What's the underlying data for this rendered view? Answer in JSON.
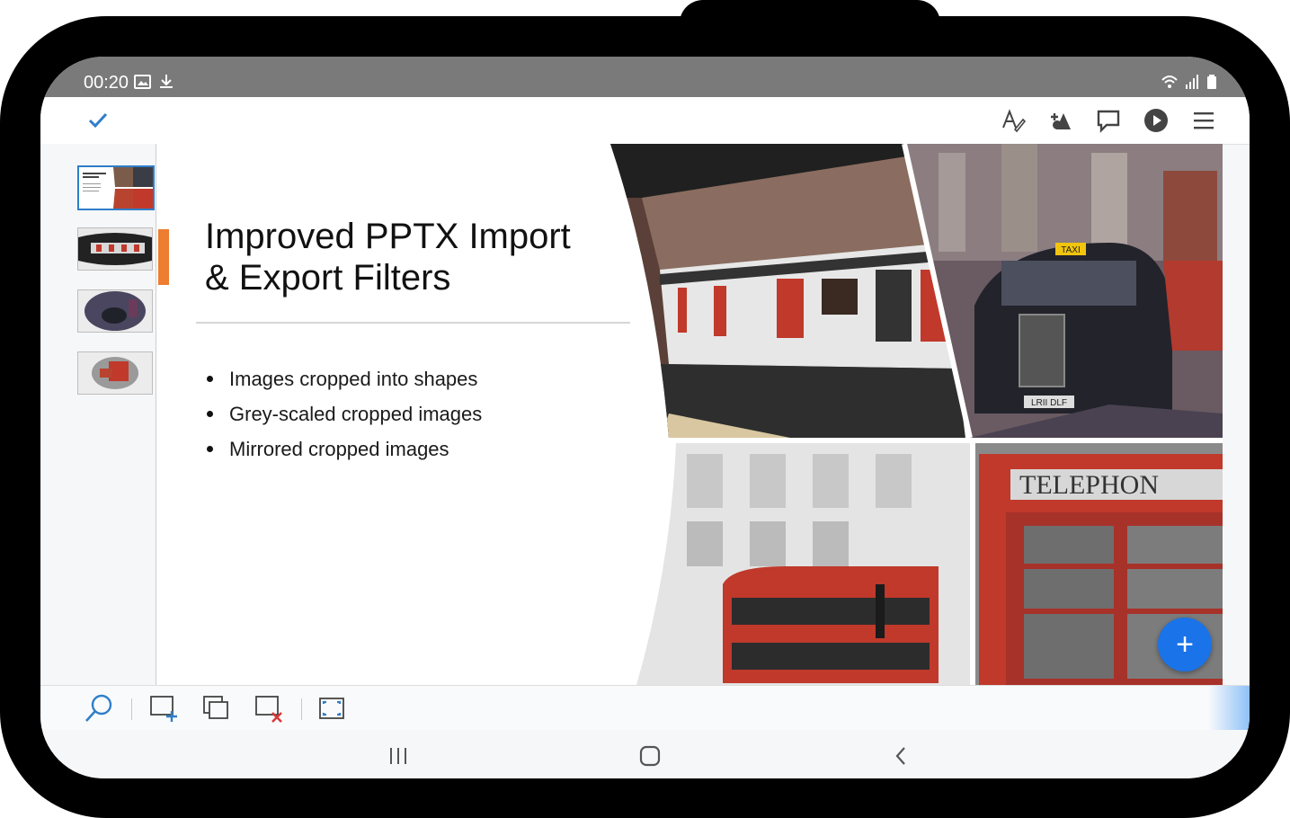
{
  "status_bar": {
    "time": "00:20",
    "icons": [
      "image-icon",
      "download-icon",
      "wifi-icon",
      "signal-icon",
      "battery-icon"
    ]
  },
  "toolbar": {
    "left": "check-icon",
    "right": [
      "text-format-icon",
      "insert-shape-icon",
      "comment-icon",
      "play-icon",
      "menu-icon"
    ]
  },
  "slide_panel": {
    "slides": [
      {
        "label": "Slide 1",
        "active": true
      },
      {
        "label": "Slide 2",
        "active": false
      },
      {
        "label": "Slide 3",
        "active": false
      },
      {
        "label": "Slide 4",
        "active": false
      }
    ]
  },
  "slide": {
    "title_line1": "Improved PPTX Import",
    "title_line2": "& Export Filters",
    "bullets": [
      "Images cropped into shapes",
      "Grey-scaled cropped images",
      "Mirrored cropped images"
    ],
    "images": [
      {
        "name": "train-photo",
        "plate": "",
        "sign": ""
      },
      {
        "name": "taxi-photo",
        "sign": "TAXI",
        "plate": "LRII DLF"
      },
      {
        "name": "bus-photo",
        "sign": "",
        "plate": ""
      },
      {
        "name": "telephone-box-photo",
        "sign": "TELEPHON",
        "plate": ""
      }
    ]
  },
  "fab": {
    "label": "+"
  },
  "bottom_toolbar": [
    "search-icon",
    "new-slide-icon",
    "duplicate-slide-icon",
    "delete-slide-icon",
    "fullscreen-icon"
  ],
  "colors": {
    "accent": "#ed7d31",
    "brand_blue": "#1a73e8",
    "check_blue": "#2f7ec9"
  }
}
